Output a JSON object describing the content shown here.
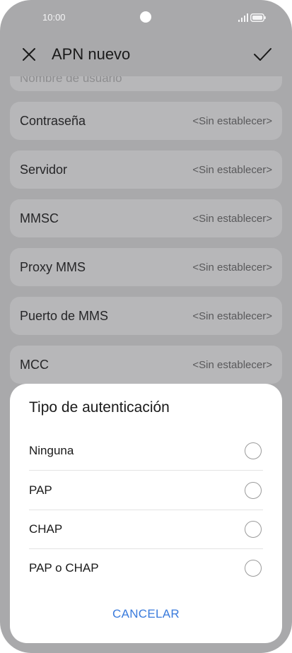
{
  "status_bar": {
    "time": "10:00"
  },
  "app_bar": {
    "title": "APN nuevo"
  },
  "settings": {
    "partial_item_label": "Nombre de usuario",
    "items": [
      {
        "label": "Contraseña",
        "value": "<Sin establecer>"
      },
      {
        "label": "Servidor",
        "value": "<Sin establecer>"
      },
      {
        "label": "MMSC",
        "value": "<Sin establecer>"
      },
      {
        "label": "Proxy MMS",
        "value": "<Sin establecer>"
      },
      {
        "label": "Puerto de MMS",
        "value": "<Sin establecer>"
      },
      {
        "label": "MCC",
        "value": "<Sin establecer>"
      }
    ]
  },
  "dialog": {
    "title": "Tipo de autenticación",
    "options": [
      {
        "label": "Ninguna",
        "selected": false
      },
      {
        "label": "PAP",
        "selected": false
      },
      {
        "label": "CHAP",
        "selected": false
      },
      {
        "label": "PAP o CHAP",
        "selected": false
      }
    ],
    "cancel_label": "CANCELAR"
  },
  "colors": {
    "scrim_background": "#a9a9ab",
    "list_item_background": "#b7b7b9",
    "dialog_background": "#ffffff",
    "accent": "#3a7bdc"
  },
  "icons": {
    "close": "close-icon",
    "confirm": "check-icon",
    "signal": "signal-icon",
    "battery": "battery-icon"
  }
}
